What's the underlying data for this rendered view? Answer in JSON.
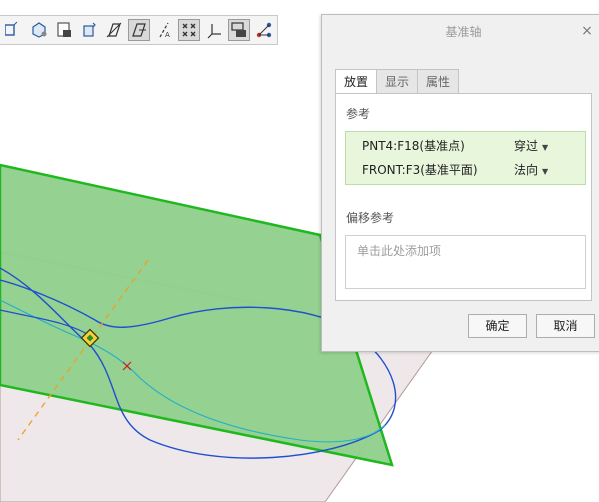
{
  "toolbar": {
    "buttons": [
      {
        "icon": "view-box-icon",
        "active": false
      },
      {
        "icon": "saved-orientation-icon",
        "active": false
      },
      {
        "icon": "view-manager-icon",
        "active": false
      },
      {
        "icon": "spin-center-icon",
        "active": false
      },
      {
        "icon": "datum-plane-display-icon",
        "active": false
      },
      {
        "icon": "datum-plane-tag-icon",
        "active": true
      },
      {
        "icon": "datum-axis-display-icon",
        "active": false
      },
      {
        "icon": "datum-point-display-icon",
        "active": true
      },
      {
        "icon": "coordinate-system-display-icon",
        "active": false
      },
      {
        "icon": "annotation-display-icon",
        "active": true
      },
      {
        "icon": "spin-center-display-icon",
        "active": false
      }
    ]
  },
  "dialog": {
    "title": "基准轴",
    "close": "×",
    "tabs": [
      "放置",
      "显示",
      "属性"
    ],
    "active_tab": "放置",
    "references_label": "参考",
    "references": [
      {
        "name": "PNT4:F18(基准点)",
        "type": "穿过"
      },
      {
        "name": "FRONT:F3(基准平面)",
        "type": "法向"
      }
    ],
    "offset_label": "偏移参考",
    "offset_placeholder": "单击此处添加项",
    "ok_label": "确定",
    "cancel_label": "取消"
  },
  "colors": {
    "plane_fill": "#8fd08c",
    "plane_edge": "#1fb81f",
    "curve": "#1f4fd0",
    "axis": "#f0a020",
    "selection_box": "#e8f7dc"
  }
}
